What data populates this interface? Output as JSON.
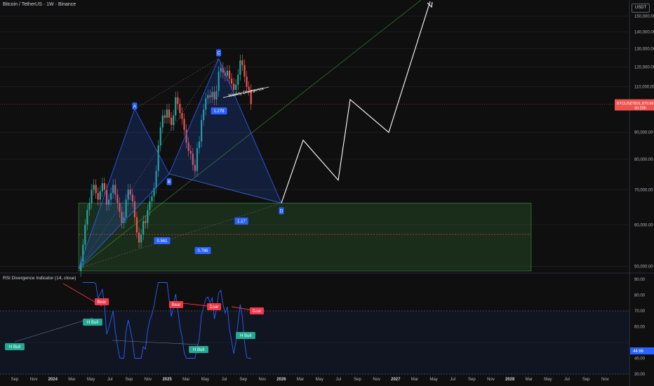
{
  "header": {
    "title": "Bitcoin / TetherUS · 1W · Binance",
    "currency_button": "USDT"
  },
  "colors": {
    "background": "#0f0f0f",
    "bull": "#26a69a",
    "bear": "#ef5350",
    "pattern_blue": "#2962ff",
    "rsi_line": "#2962ff",
    "zone_green": "#4caf50",
    "label_red": "#f23645",
    "label_green": "#22ab94"
  },
  "chart_data": [
    {
      "type": "candlestick",
      "title": "Bitcoin / TetherUS · 1W · Binance",
      "y_scale": "log",
      "ylim": [
        49000,
        160000
      ],
      "y_ticks": [
        50000,
        60000,
        70000,
        80000,
        90000,
        110000,
        120000,
        130000,
        140000,
        150000
      ],
      "y_tick_labels": [
        "50,000.00",
        "60,000.00",
        "70,000.00",
        "80,000.00",
        "90,000.00",
        "110,000.00",
        "120,000.00",
        "130,000.00",
        "140,000.00",
        "150,000.00"
      ],
      "x_tick_labels": [
        "Sep",
        "Nov",
        "2024",
        "Mar",
        "May",
        "Jul",
        "Sep",
        "Nov",
        "2025",
        "Mar",
        "May",
        "Jul",
        "Sep",
        "Nov",
        "2026",
        "Mar",
        "May",
        "Jul",
        "Sep",
        "Nov",
        "2027",
        "Mar",
        "May",
        "Jul",
        "Sep",
        "Nov",
        "2028",
        "Mar",
        "May",
        "Jul",
        "Sep",
        "Nov"
      ],
      "last_price": {
        "symbol": "BTCUSDT",
        "value": "101,879.99",
        "countdown": "4d 20h"
      },
      "weekly_closes": [
        51000,
        55000,
        60000,
        64000,
        66000,
        70000,
        71500,
        69000,
        67000,
        69500,
        72000,
        70000,
        65500,
        67000,
        69000,
        71500,
        68500,
        66000,
        63500,
        60500,
        62000,
        67000,
        70000,
        68500,
        66500,
        62000,
        58000,
        55500,
        57500,
        61000,
        60500,
        64000,
        66500,
        68000,
        70500,
        76000,
        85000,
        92000,
        97000,
        96000,
        99500,
        96000,
        93000,
        97000,
        105000,
        102000,
        98000,
        95500,
        91000,
        86000,
        83000,
        82000,
        78000,
        76000,
        84000,
        86500,
        95000,
        99500,
        104500,
        106000,
        105000,
        107500,
        104000,
        108000,
        117500,
        119500,
        117000,
        115500,
        118000,
        114000,
        111500,
        108500,
        111000,
        116000,
        123500,
        121000,
        115000,
        110000,
        108500,
        101880
      ],
      "harmonic_pattern": {
        "points": [
          {
            "label": "A",
            "price": 99800
          },
          {
            "label": "B",
            "price": 75000
          },
          {
            "label": "C",
            "price": 124500
          },
          {
            "label": "D",
            "price": 66000
          }
        ],
        "ratios": [
          "0.561",
          "1.278",
          "1.17",
          "0.786"
        ],
        "annotation": "Weekly Divergence"
      },
      "demand_zone": {
        "low": 49000,
        "high": 66000,
        "mid": 57500
      },
      "projection_path": [
        66000,
        87000,
        73000,
        104000,
        90000,
        160000
      ]
    },
    {
      "type": "line",
      "title": "RSI Divergence Indicator (14, close)",
      "ylim": [
        30,
        90
      ],
      "y_tick_labels": [
        "90.00",
        "80.00",
        "70.00",
        "60.00",
        "40.00",
        "30.00"
      ],
      "bands": {
        "upper": 70,
        "lower": 30,
        "mid": 50
      },
      "current_value": "44.66",
      "labels": [
        "Bear",
        "Bear",
        "Bear",
        "Bear",
        "H Bull",
        "H Bull",
        "H Bull",
        "H Bull"
      ]
    }
  ]
}
